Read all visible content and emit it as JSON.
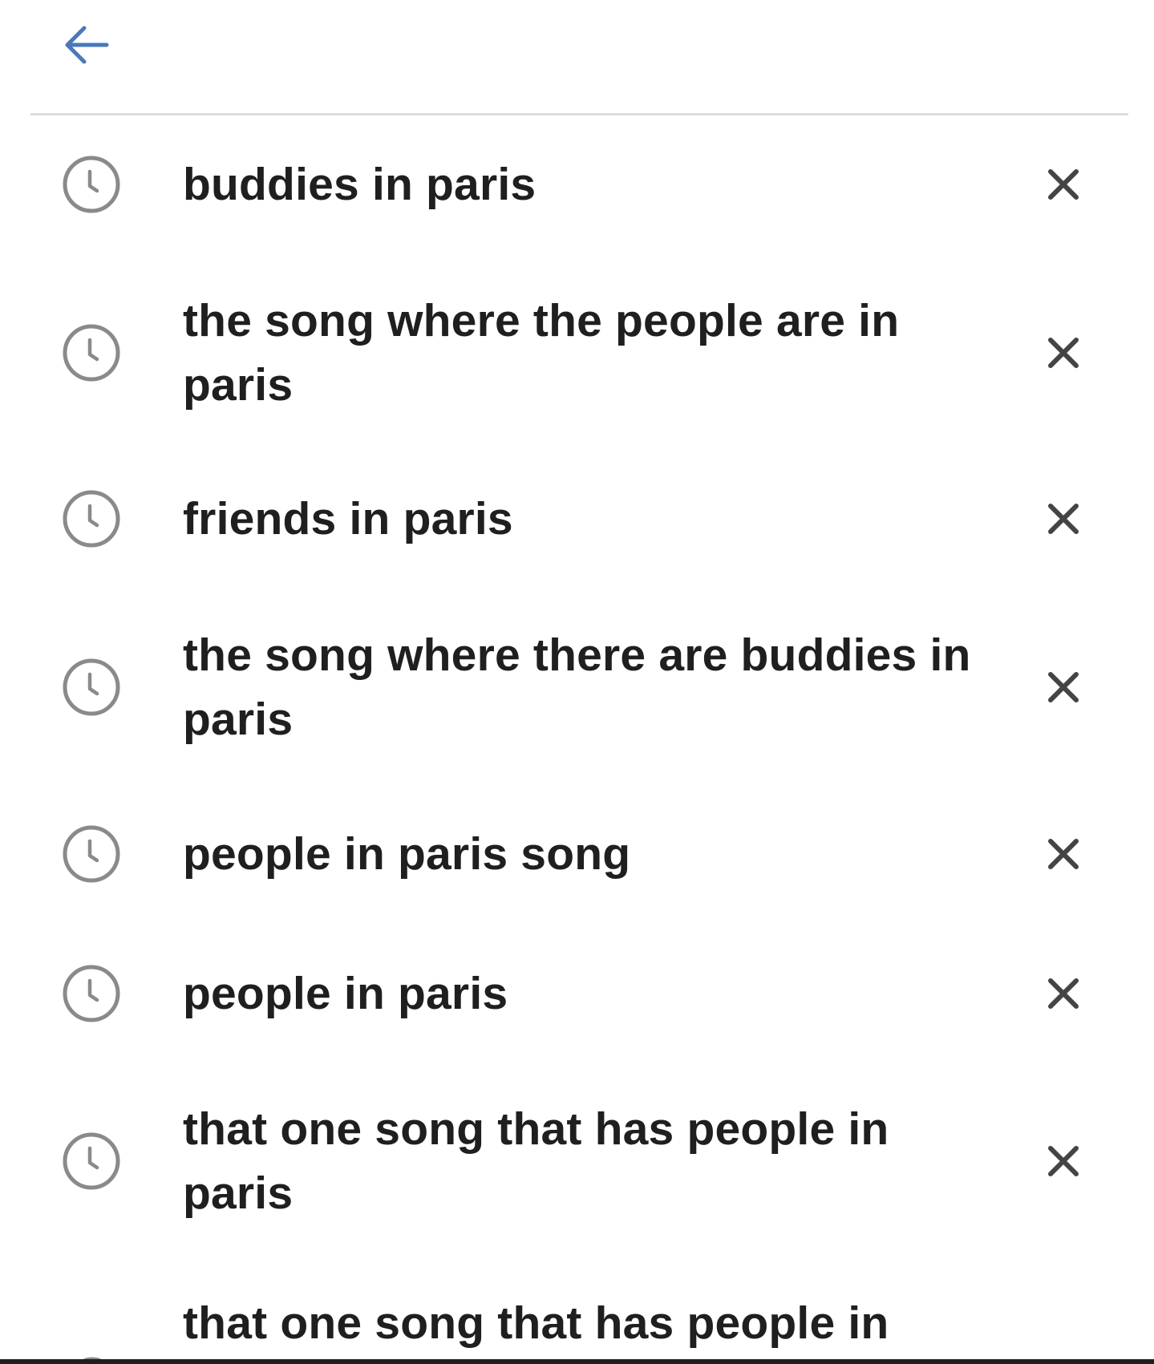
{
  "header": {
    "back_icon": "arrow-left-icon",
    "accent_color": "#4a78bd"
  },
  "history": {
    "item_icon": "clock-icon",
    "remove_icon": "close-icon",
    "items": [
      {
        "label": "buddies in paris"
      },
      {
        "label": "the song where the people are in paris"
      },
      {
        "label": "friends in paris"
      },
      {
        "label": "the song where there are buddies in paris"
      },
      {
        "label": "people in paris song"
      },
      {
        "label": "people in paris"
      },
      {
        "label": "that one song that has people in paris"
      },
      {
        "label": "that one song that has people in"
      }
    ]
  }
}
